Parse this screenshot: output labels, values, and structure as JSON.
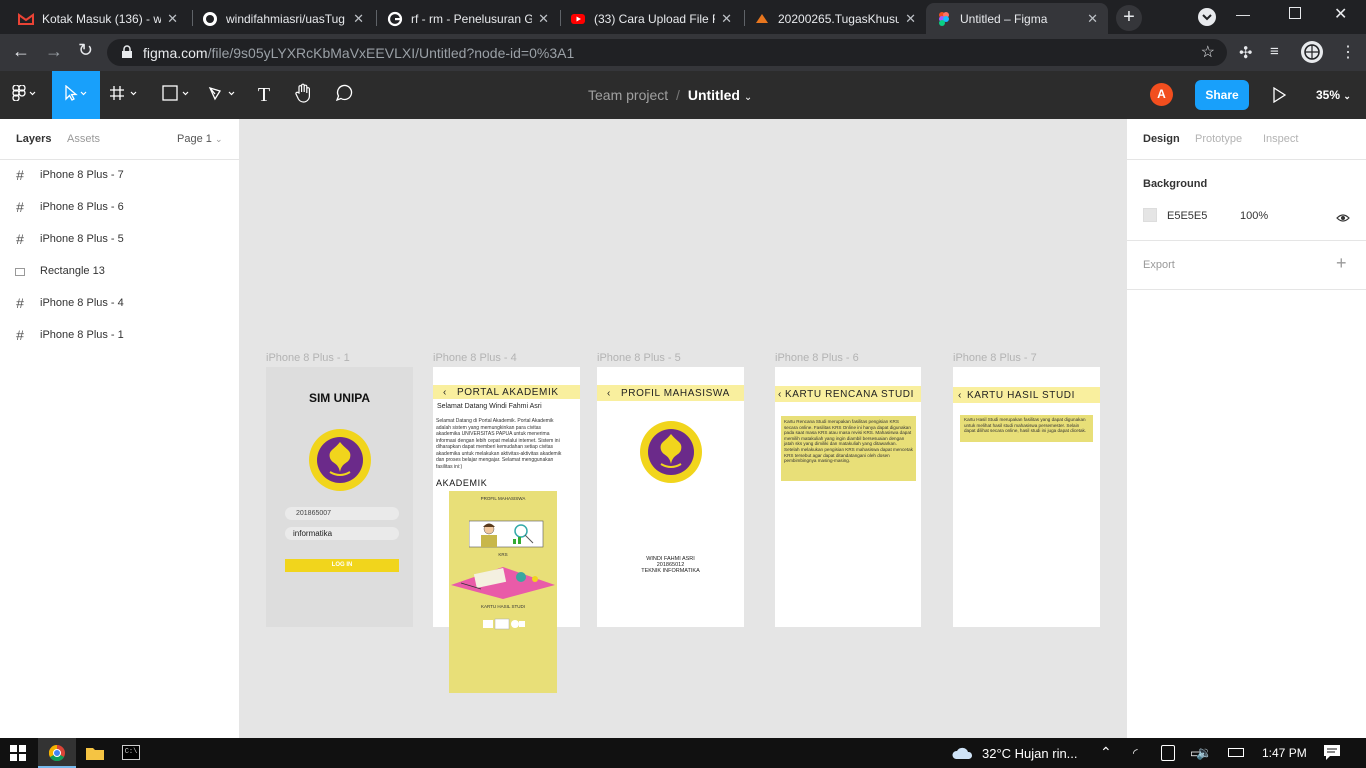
{
  "browser": {
    "tabs": [
      {
        "title": "Kotak Masuk (136) - w",
        "icon": "gmail-icon",
        "color": "#ea4335"
      },
      {
        "title": "windifahmiasri/uasTug",
        "icon": "github-icon",
        "color": "#ffffff"
      },
      {
        "title": "rf - rm - Penelusuran G",
        "icon": "google-icon",
        "color": "#4285f4"
      },
      {
        "title": "(33) Cara Upload File F",
        "icon": "youtube-icon",
        "color": "#ff0000"
      },
      {
        "title": "20200265.TugasKhusu",
        "icon": "xd-icon",
        "color": "#e8761e"
      },
      {
        "title": "Untitled – Figma",
        "icon": "figma-icon",
        "color": "#a259ff"
      }
    ],
    "url_host": "figma.com",
    "url_path": "/file/9s05yLYXRcKbMaVxEEVLXI/Untitled?node-id=0%3A1"
  },
  "figma": {
    "breadcrumb_team": "Team project",
    "breadcrumb_sep": "/",
    "file_name": "Untitled",
    "avatar_letter": "A",
    "share_label": "Share",
    "zoom": "35%",
    "accent": "#18a0fb",
    "left_tabs": {
      "layers": "Layers",
      "assets": "Assets",
      "page": "Page 1"
    },
    "layers": [
      {
        "name": "iPhone 8 Plus - 7",
        "icon": "frame-icon"
      },
      {
        "name": "iPhone 8 Plus - 6",
        "icon": "frame-icon"
      },
      {
        "name": "iPhone 8 Plus - 5",
        "icon": "frame-icon"
      },
      {
        "name": "Rectangle 13",
        "icon": "rectangle-icon"
      },
      {
        "name": "iPhone 8 Plus - 4",
        "icon": "frame-icon"
      },
      {
        "name": "iPhone 8 Plus - 1",
        "icon": "frame-icon"
      }
    ],
    "right_tabs": {
      "design": "Design",
      "prototype": "Prototype",
      "inspect": "Inspect"
    },
    "background_label": "Background",
    "background_hex": "E5E5E5",
    "background_opacity": "100%",
    "export_label": "Export",
    "help": "?"
  },
  "frames": {
    "f1": {
      "label": "iPhone 8 Plus - 1",
      "title": "SIM UNIPA",
      "nim": "201865007",
      "password": "informatika",
      "login": "LOG IN",
      "seal_text": "UNIVERSITAS NEGERI PAPUA"
    },
    "f4": {
      "label": "iPhone 8 Plus - 4",
      "header": "PORTAL AKADEMIK",
      "welcome": "Selamat Datang Windi Fahmi Asri",
      "para": "Selamat Datang di Portal Akademik. Portal Akademik adalah sistem yang memungkinkan para civitas akademika UNIVERSITAS PAPUA untuk menerima informasi dengan lebih cepat melalui internet. Sistem ini diharapkan dapat memberi kemudahan setiap civitas akademika untuk melakukan aktivitas-aktivitas akademik dan proses belajar mengajar. Selamat menggunakan fasilitas ini:)",
      "section": "AKADEMIK",
      "menu1": "PROFIL MAHASISWA",
      "menu2": "KRS",
      "menu3": "KARTU HASIL STUDI"
    },
    "f5": {
      "label": "iPhone 8 Plus - 5",
      "header": "PROFIL MAHASISWA",
      "name": "WINDI FAHMI ASRI",
      "nim": "201865012",
      "prodi": "TEKNIK INFORMATIKA"
    },
    "f6": {
      "label": "iPhone 8 Plus - 6",
      "header": "KARTU RENCANA STUDI",
      "para": "Kartu Rencana Studi merupakan fasilitas pengisian KRS secara online. Fasilitas KRS Online ini hanya dapat digunakan pada saat masa KRS atau masa revisi KRS. Mahasiswa dapat memilih matakuliah yang ingin diambil bersesuaian dengan jatah sks yang dimiliki dan matakuliah yang ditawarkan. Setelah melakukan pengisian KRS mahasiswa dapat mencetak KRS tersebut agar dapat ditandatangani oleh dosen pembimbingnya masing-masing."
    },
    "f7": {
      "label": "iPhone 8 Plus - 7",
      "header": "KARTU HASIL STUDI",
      "para": "Kartu Hasil Studi merupakan fasilitas yang dapat digunakan untuk melihat hasil studi mahasiswa persemester. Selain dapat dilihat secara online, hasil studi ini juga dapat dicetak."
    }
  },
  "taskbar": {
    "weather": "32°C  Hujan rin...",
    "time": "1:47 PM"
  }
}
